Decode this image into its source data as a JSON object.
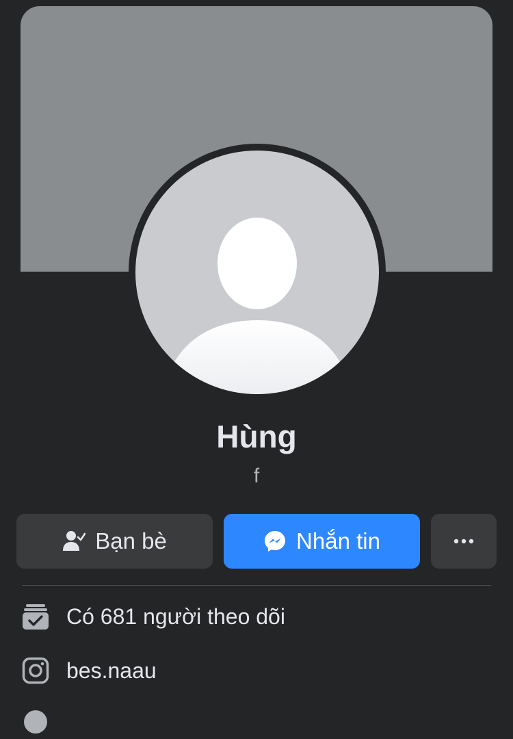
{
  "profile": {
    "name": "Hùng",
    "subtitle": "f"
  },
  "actions": {
    "friends_label": "Bạn bè",
    "message_label": "Nhắn tin",
    "more_label": "More options"
  },
  "info": {
    "followers_text": "Có 681 người theo dõi",
    "instagram_handle": "bes.naau"
  },
  "icons": {
    "friends": "person-check-icon",
    "message": "messenger-icon",
    "more": "more-dots-icon",
    "followers": "followers-badge-icon",
    "instagram": "instagram-icon",
    "partial_row": "info-icon"
  },
  "colors": {
    "background": "#242527",
    "cover": "#8a8d90",
    "accent": "#2d88ff",
    "button_secondary": "#3a3b3c"
  }
}
